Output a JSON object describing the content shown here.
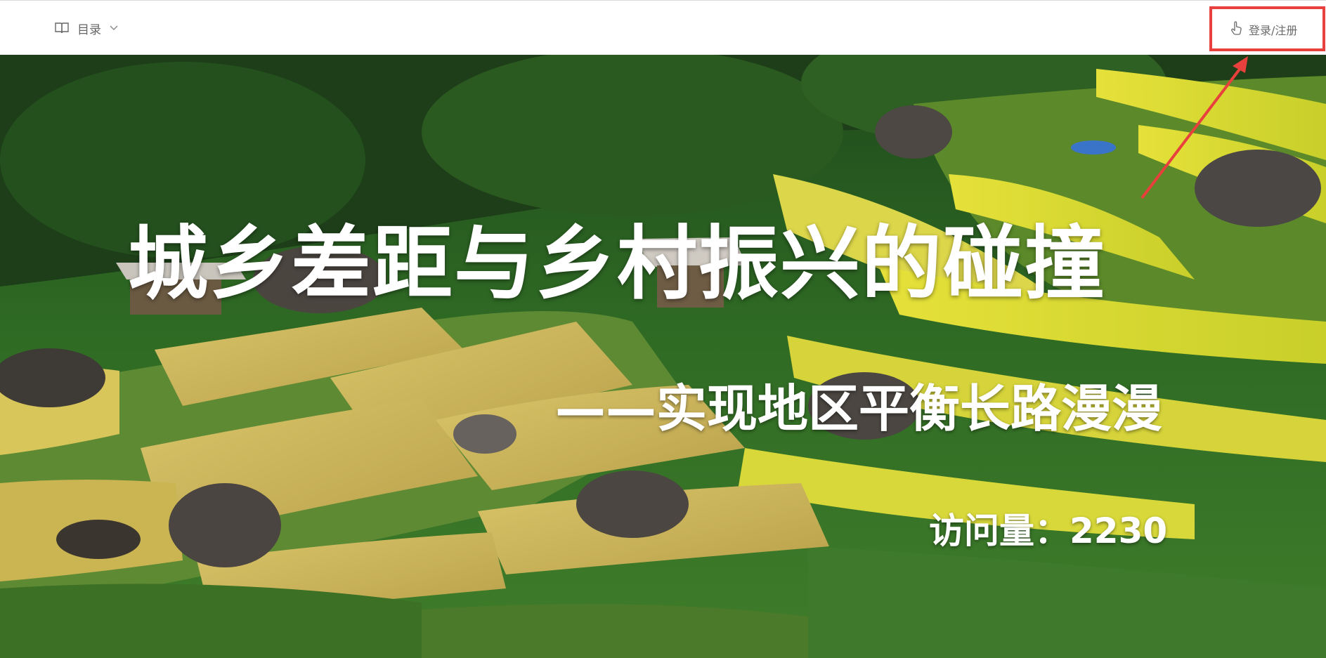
{
  "header": {
    "toc_label": "目录",
    "login_label": "登录/注册"
  },
  "hero": {
    "title": "城乡差距与乡村振兴的碰撞",
    "subtitle": "——实现地区平衡长路漫漫",
    "visits_label": "访问量：",
    "visits_count": "2230"
  },
  "colors": {
    "highlight_box": "#e8403c",
    "header_text": "#666666",
    "hero_text": "#ffffff"
  },
  "icons": {
    "toc": "book-icon",
    "toc_dropdown": "chevron-down-icon",
    "login": "hand-pointer-icon"
  }
}
